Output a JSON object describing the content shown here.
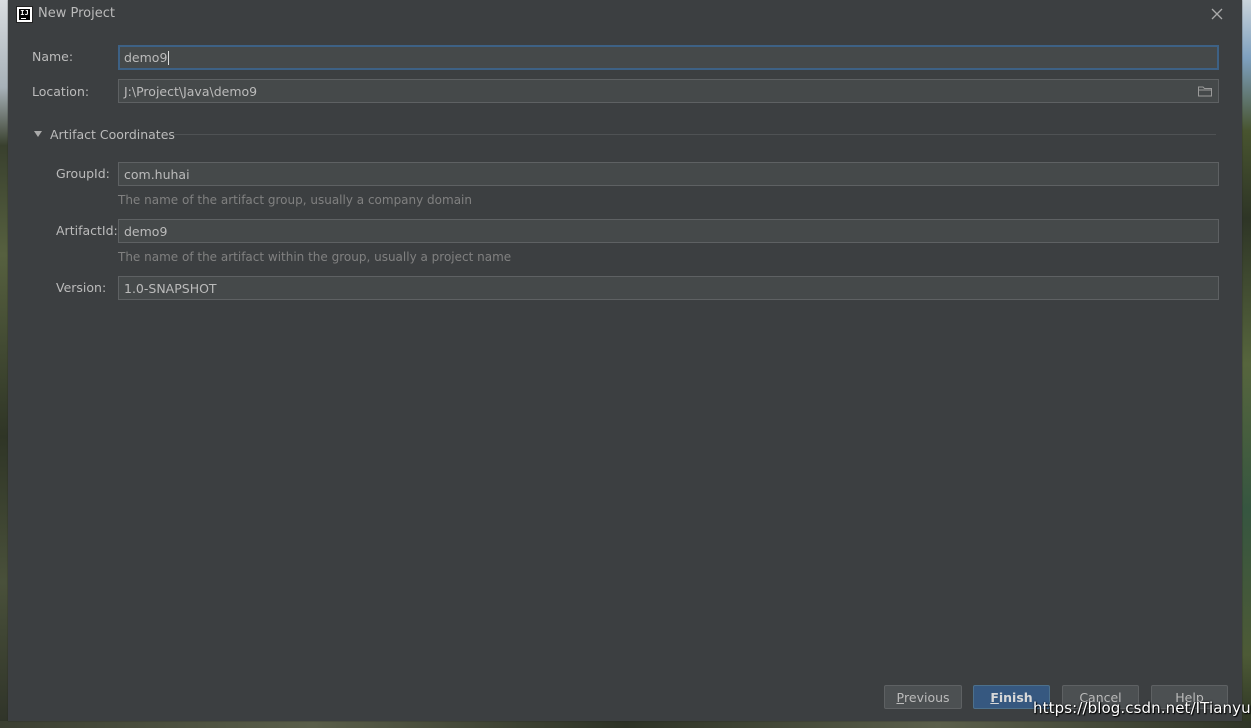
{
  "window": {
    "title": "New Project"
  },
  "form": {
    "name": {
      "label": "Name:",
      "value": "demo9"
    },
    "location": {
      "label": "Location:",
      "value": "J:\\Project\\Java\\demo9"
    }
  },
  "artifact": {
    "section_title": "Artifact Coordinates",
    "group_id": {
      "label": "GroupId:",
      "value": "com.huhai",
      "hint": "The name of the artifact group, usually a company domain"
    },
    "artifact_id": {
      "label": "ArtifactId:",
      "value": "demo9",
      "hint": "The name of the artifact within the group, usually a project name"
    },
    "version": {
      "label": "Version:",
      "value": "1.0-SNAPSHOT"
    }
  },
  "buttons": {
    "previous": {
      "mnemonic": "P",
      "rest": "revious"
    },
    "finish": {
      "mnemonic": "F",
      "rest": "inish"
    },
    "cancel": {
      "label": "Cancel"
    },
    "help": {
      "label": "Help"
    }
  },
  "icons": {
    "app": "intellij-idea-icon",
    "close": "close-icon",
    "folder": "folder-icon",
    "collapse": "triangle-down-icon"
  },
  "watermark": "https://blog.csdn.net/ITianyue",
  "colors": {
    "dialog_bg": "#3c3f41",
    "field_bg": "#45494a",
    "focus_border": "#3d6185",
    "primary_button": "#365880",
    "text": "#bbbbbb",
    "hint_text": "#808080"
  }
}
